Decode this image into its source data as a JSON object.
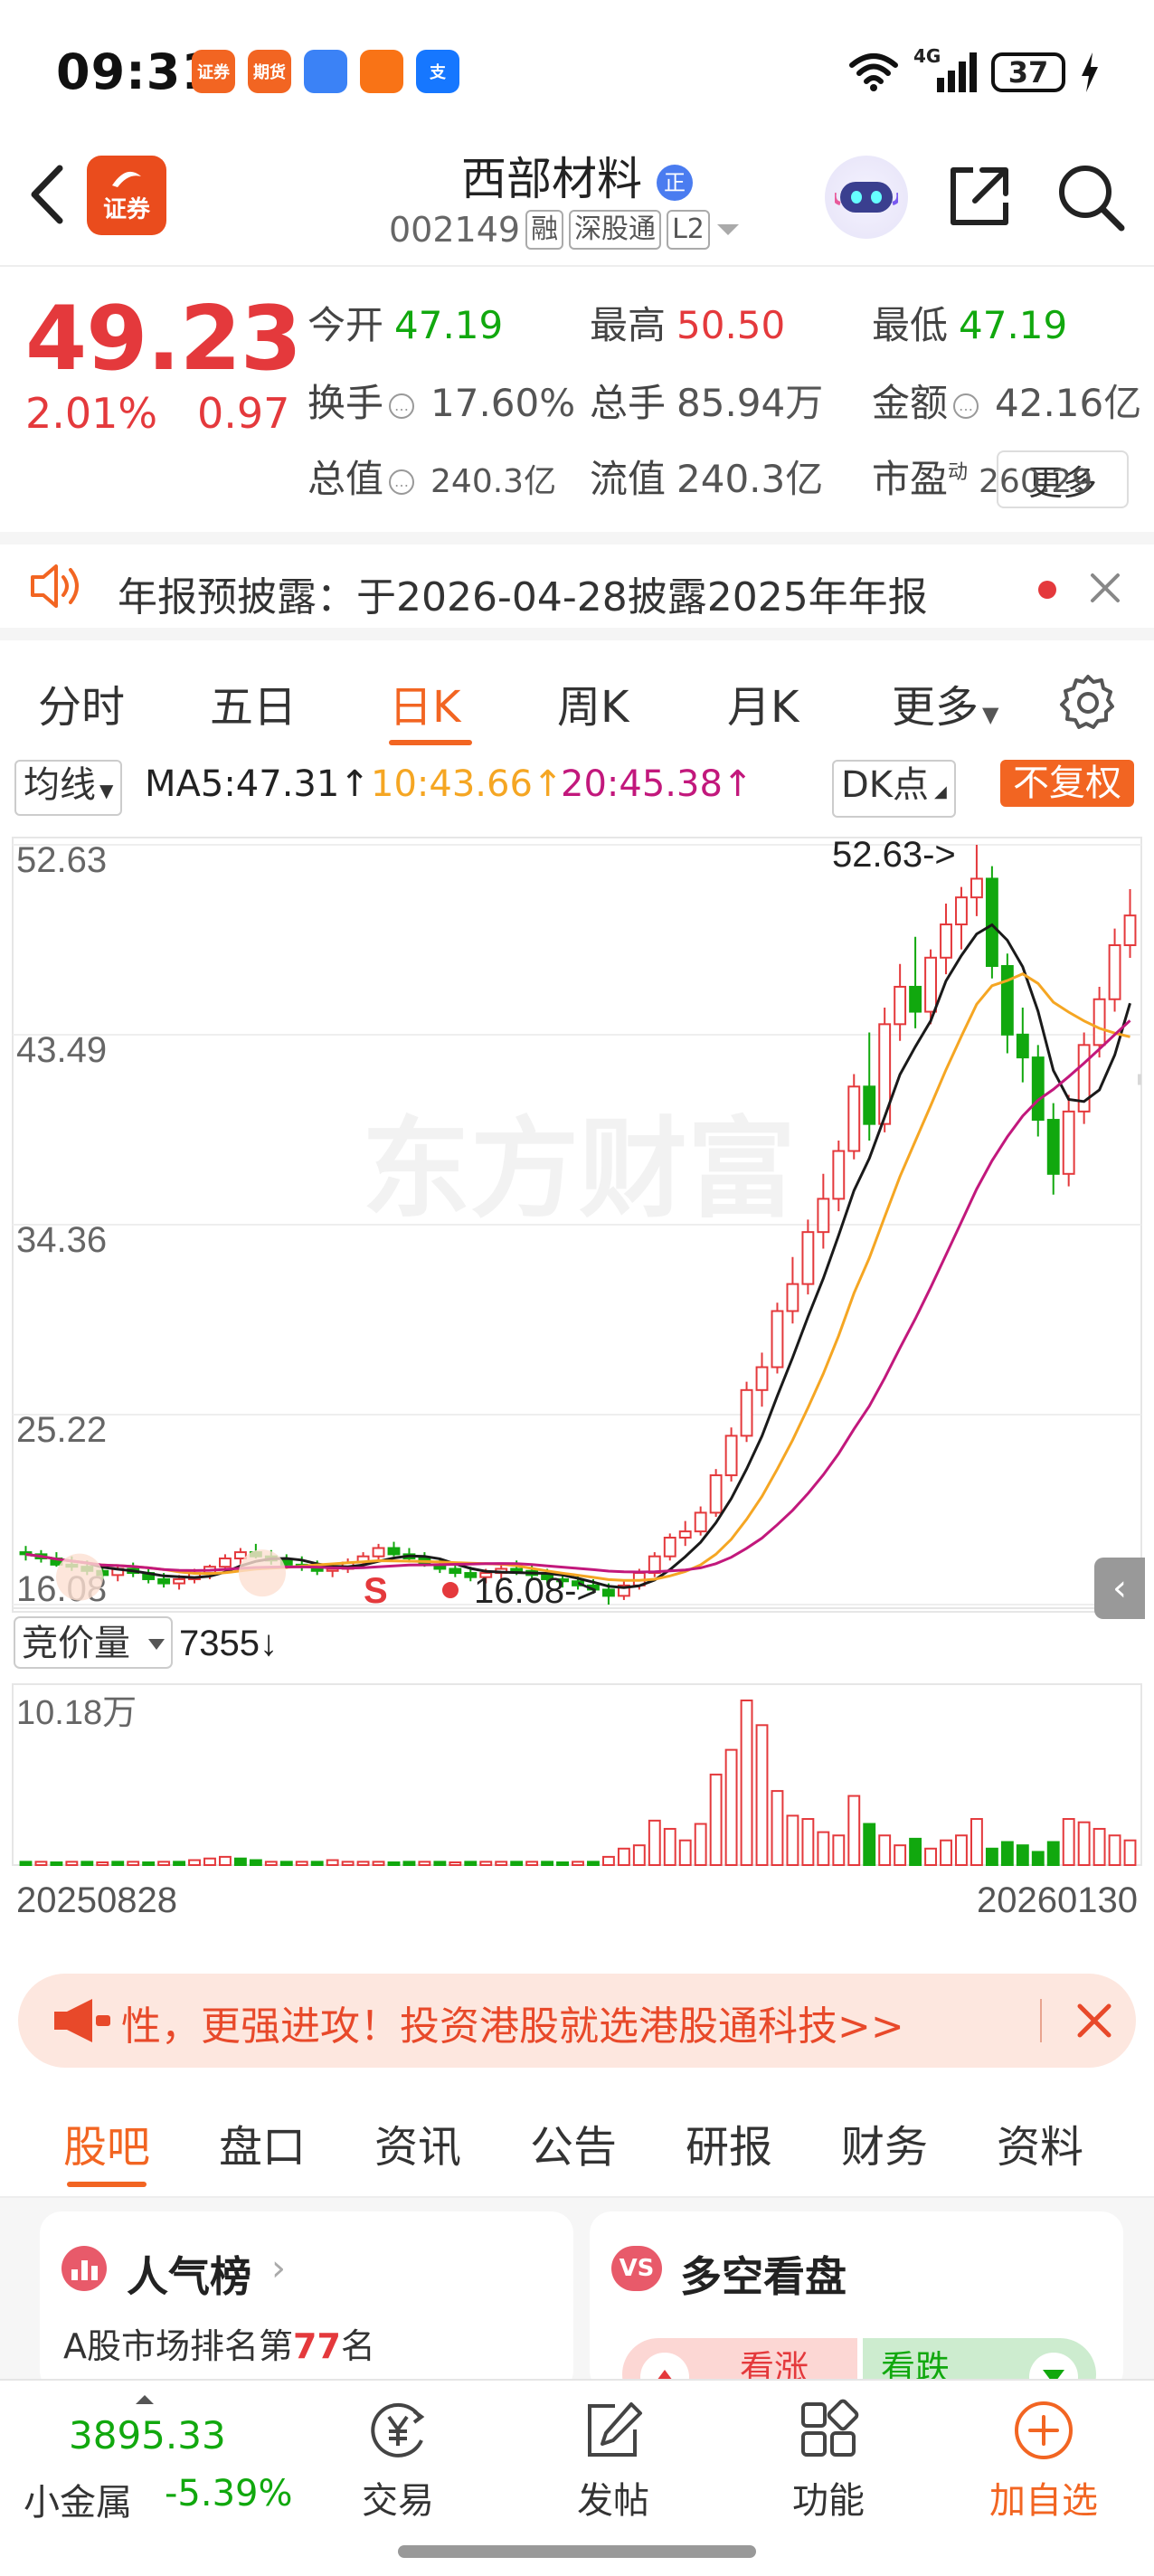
{
  "status_bar": {
    "time": "09:31",
    "notif_icons": [
      {
        "label": "证券",
        "color": "#f26522"
      },
      {
        "label": "期货",
        "color": "#f26522"
      },
      {
        "label": "",
        "color": "#3b82f6"
      },
      {
        "label": "",
        "color": "#f97316"
      },
      {
        "label": "支",
        "color": "#1677ff"
      }
    ],
    "signal": "4G",
    "battery": "37"
  },
  "header": {
    "app_badge": "证券",
    "stock_name": "西部材料",
    "name_badge": "正",
    "code": "002149",
    "tags": [
      "融",
      "深股通",
      "L2"
    ]
  },
  "quote": {
    "price": "49.23",
    "change_pct": "2.01%",
    "change": "0.97",
    "rows": [
      [
        {
          "k": "今开",
          "v": "47.19",
          "c": "green"
        },
        {
          "k": "最高",
          "v": "50.50",
          "c": "red"
        },
        {
          "k": "最低",
          "v": "47.19",
          "c": "green"
        }
      ],
      [
        {
          "k": "换手",
          "v": "17.60%",
          "c": "gray"
        },
        {
          "k": "总手",
          "v": "85.94万",
          "c": "gray"
        },
        {
          "k": "金额",
          "v": "42.16亿",
          "c": "gray"
        }
      ],
      [
        {
          "k": "总值",
          "v": "240.3亿",
          "c": "gray"
        },
        {
          "k": "流值",
          "v": "240.3亿",
          "c": "gray"
        },
        {
          "k": "市盈",
          "v": "260.29",
          "c": "gray",
          "sup": "动"
        }
      ]
    ],
    "more_label": "更多"
  },
  "notice": {
    "text": "年报预披露：于2026-04-28披露2025年年报"
  },
  "chart_tabs": [
    "分时",
    "五日",
    "日K",
    "周K",
    "月K",
    "更多"
  ],
  "chart_tabs_active": 2,
  "chart_toolbar": {
    "indicator": "均线",
    "ma5": "MA5:47.31↑",
    "ma10": "10:43.66↑",
    "ma20": "20:45.38↑",
    "dk": "DK点",
    "fq": "不复权"
  },
  "chart_data": {
    "type": "candlestick",
    "y_ticks": [
      "52.63",
      "43.49",
      "34.36",
      "25.22",
      "16.08"
    ],
    "ylim": [
      16.08,
      52.63
    ],
    "high_annotation": "52.63->",
    "low_annotation": "16.08->",
    "watermark": "东方财富",
    "start_date": "20250828",
    "end_date": "20260130",
    "candles_ohlc": [
      [
        18.6,
        18.9,
        18.2,
        18.5
      ],
      [
        18.5,
        18.7,
        18.1,
        18.3
      ],
      [
        18.3,
        18.6,
        17.9,
        18.0
      ],
      [
        18.0,
        18.4,
        17.7,
        17.9
      ],
      [
        17.9,
        18.2,
        17.5,
        17.7
      ],
      [
        17.7,
        18.0,
        17.3,
        17.5
      ],
      [
        17.5,
        17.9,
        17.2,
        17.8
      ],
      [
        17.8,
        18.1,
        17.4,
        17.6
      ],
      [
        17.6,
        17.9,
        17.1,
        17.3
      ],
      [
        17.3,
        17.6,
        16.9,
        17.1
      ],
      [
        17.1,
        17.5,
        16.8,
        17.3
      ],
      [
        17.3,
        17.8,
        17.1,
        17.6
      ],
      [
        17.6,
        18.0,
        17.3,
        17.9
      ],
      [
        17.9,
        18.5,
        17.7,
        18.3
      ],
      [
        18.3,
        18.8,
        18.0,
        18.6
      ],
      [
        18.6,
        19.0,
        18.3,
        18.4
      ],
      [
        18.4,
        18.7,
        18.0,
        18.2
      ],
      [
        18.2,
        18.5,
        17.8,
        18.0
      ],
      [
        18.0,
        18.4,
        17.7,
        17.9
      ],
      [
        17.9,
        18.2,
        17.5,
        17.7
      ],
      [
        17.7,
        18.0,
        17.4,
        17.8
      ],
      [
        17.8,
        18.3,
        17.6,
        18.1
      ],
      [
        18.1,
        18.6,
        17.9,
        18.4
      ],
      [
        18.4,
        19.0,
        18.2,
        18.8
      ],
      [
        18.8,
        19.1,
        18.4,
        18.5
      ],
      [
        18.5,
        18.8,
        18.1,
        18.3
      ],
      [
        18.3,
        18.6,
        17.9,
        18.0
      ],
      [
        18.0,
        18.3,
        17.6,
        17.8
      ],
      [
        17.8,
        18.1,
        17.4,
        17.6
      ],
      [
        17.6,
        17.9,
        17.2,
        17.4
      ],
      [
        17.4,
        17.8,
        17.1,
        17.6
      ],
      [
        17.6,
        18.0,
        17.3,
        17.8
      ],
      [
        17.8,
        18.2,
        17.5,
        17.7
      ],
      [
        17.7,
        18.0,
        17.3,
        17.5
      ],
      [
        17.5,
        17.8,
        17.1,
        17.3
      ],
      [
        17.3,
        17.6,
        16.9,
        17.2
      ],
      [
        17.2,
        17.5,
        16.8,
        17.0
      ],
      [
        17.0,
        17.3,
        16.6,
        16.8
      ],
      [
        16.8,
        17.1,
        16.08,
        16.5
      ],
      [
        16.5,
        17.2,
        16.3,
        17.0
      ],
      [
        17.0,
        17.8,
        16.8,
        17.6
      ],
      [
        17.6,
        18.6,
        17.4,
        18.4
      ],
      [
        18.4,
        19.5,
        18.2,
        19.3
      ],
      [
        19.3,
        20.1,
        18.9,
        19.6
      ],
      [
        19.6,
        20.8,
        19.4,
        20.5
      ],
      [
        20.5,
        22.6,
        20.3,
        22.3
      ],
      [
        22.3,
        24.6,
        22.0,
        24.2
      ],
      [
        24.2,
        26.8,
        23.9,
        26.4
      ],
      [
        26.4,
        28.2,
        25.6,
        27.5
      ],
      [
        27.5,
        30.6,
        27.2,
        30.2
      ],
      [
        30.2,
        32.8,
        29.6,
        31.5
      ],
      [
        31.5,
        34.6,
        31.0,
        34.0
      ],
      [
        34.0,
        36.8,
        33.2,
        35.6
      ],
      [
        35.6,
        38.4,
        35.0,
        37.9
      ],
      [
        37.9,
        41.6,
        37.5,
        41.0
      ],
      [
        41.0,
        43.6,
        38.4,
        39.2
      ],
      [
        39.2,
        44.8,
        38.8,
        44.0
      ],
      [
        44.0,
        46.9,
        43.2,
        45.8
      ],
      [
        45.8,
        48.2,
        43.8,
        44.6
      ],
      [
        44.6,
        47.6,
        44.0,
        47.2
      ],
      [
        47.2,
        49.8,
        46.4,
        48.8
      ],
      [
        48.8,
        50.6,
        47.6,
        50.1
      ],
      [
        50.1,
        52.63,
        49.2,
        51.0
      ],
      [
        51.0,
        51.6,
        46.2,
        46.8
      ],
      [
        46.8,
        47.4,
        42.6,
        43.5
      ],
      [
        43.5,
        44.8,
        41.2,
        42.4
      ],
      [
        42.4,
        43.0,
        38.6,
        39.4
      ],
      [
        39.4,
        40.2,
        35.8,
        36.8
      ],
      [
        36.8,
        40.6,
        36.2,
        39.8
      ],
      [
        39.8,
        43.6,
        39.2,
        43.0
      ],
      [
        43.0,
        45.8,
        42.4,
        45.2
      ],
      [
        45.2,
        48.6,
        44.6,
        47.8
      ],
      [
        47.8,
        50.5,
        47.19,
        49.23
      ]
    ],
    "ma_colors": {
      "ma5": "#1a1a1a",
      "ma10": "#f5a623",
      "ma20": "#c2187c"
    }
  },
  "volume": {
    "indicator": "竞价量",
    "value": "7355↓",
    "top_label": "10.18万",
    "bars": [
      0.02,
      0.02,
      0.01,
      0.02,
      0.02,
      0.01,
      0.02,
      0.02,
      0.01,
      0.02,
      0.02,
      0.03,
      0.04,
      0.05,
      0.04,
      0.03,
      0.02,
      0.02,
      0.02,
      0.02,
      0.03,
      0.02,
      0.02,
      0.02,
      0.01,
      0.02,
      0.02,
      0.02,
      0.01,
      0.02,
      0.02,
      0.02,
      0.02,
      0.02,
      0.02,
      0.01,
      0.02,
      0.02,
      0.05,
      0.1,
      0.12,
      0.27,
      0.22,
      0.15,
      0.25,
      0.55,
      0.7,
      1.0,
      0.85,
      0.45,
      0.3,
      0.28,
      0.2,
      0.18,
      0.42,
      0.25,
      0.18,
      0.12,
      0.16,
      0.1,
      0.15,
      0.18,
      0.28,
      0.1,
      0.14,
      0.12,
      0.08,
      0.14,
      0.28,
      0.26,
      0.22,
      0.18,
      0.15
    ],
    "bar_dirs": [
      0,
      1,
      0,
      1,
      0,
      1,
      0,
      1,
      0,
      1,
      0,
      1,
      1,
      1,
      0,
      0,
      1,
      0,
      1,
      0,
      1,
      1,
      1,
      1,
      0,
      0,
      1,
      0,
      1,
      0,
      1,
      1,
      0,
      1,
      0,
      0,
      1,
      0,
      1,
      1,
      1,
      1,
      1,
      1,
      1,
      1,
      1,
      1,
      1,
      1,
      1,
      1,
      1,
      1,
      1,
      0,
      1,
      1,
      0,
      1,
      1,
      1,
      1,
      0,
      0,
      0,
      0,
      0,
      1,
      1,
      1,
      1,
      1
    ]
  },
  "banner": {
    "text": "性，更强进攻！投资港股就选港股通科技>>"
  },
  "footer_tabs": [
    "股吧",
    "盘口",
    "资讯",
    "公告",
    "研报",
    "财务",
    "资料"
  ],
  "footer_tabs_active": 0,
  "cards": {
    "left_title": "人气榜",
    "left_sub_prefix": "A股市场排名第",
    "left_rank": "77",
    "left_sub_suffix": "名",
    "right_title": "多空看盘",
    "bull": "看涨",
    "bear": "看跌"
  },
  "bottom_nav": {
    "index_value": "3895.33",
    "index_name": "小金属",
    "index_change": "-5.39%",
    "items": [
      "交易",
      "发帖",
      "功能",
      "加自选"
    ]
  }
}
